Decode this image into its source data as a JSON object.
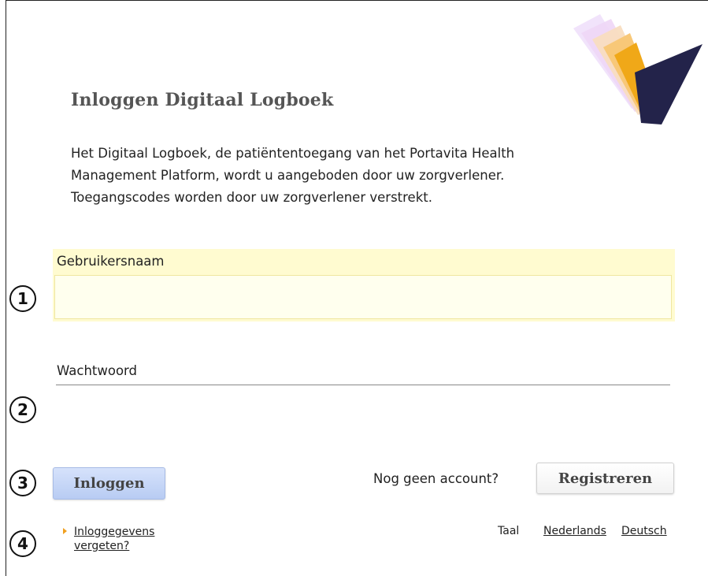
{
  "page": {
    "title": "Inloggen Digitaal Logboek",
    "intro_lines": [
      "Het Digitaal Logboek, de patiëntentoegang van het Portavita Health",
      "Management Platform, wordt u aangeboden door uw zorgverlener.",
      "Toegangscodes worden door uw zorgverlener verstrekt."
    ]
  },
  "form": {
    "username_label": "Gebruikersnaam",
    "username_value": "",
    "password_label": "Wachtwoord",
    "password_value": "",
    "login_label": "Inloggen"
  },
  "register": {
    "prompt": "Nog geen account?",
    "button_label": "Registreren"
  },
  "forgot": {
    "line1": "Inloggegevens",
    "line2": "vergeten?"
  },
  "language": {
    "label": "Taal",
    "options": [
      "Nederlands",
      "Deutsch"
    ]
  },
  "markers": [
    "1",
    "2",
    "3",
    "4"
  ],
  "colors": {
    "username_highlight": "#fffbd0",
    "login_button": "#c6d6f7",
    "logo_dark": "#23234a",
    "logo_accent": "#f0a818"
  }
}
